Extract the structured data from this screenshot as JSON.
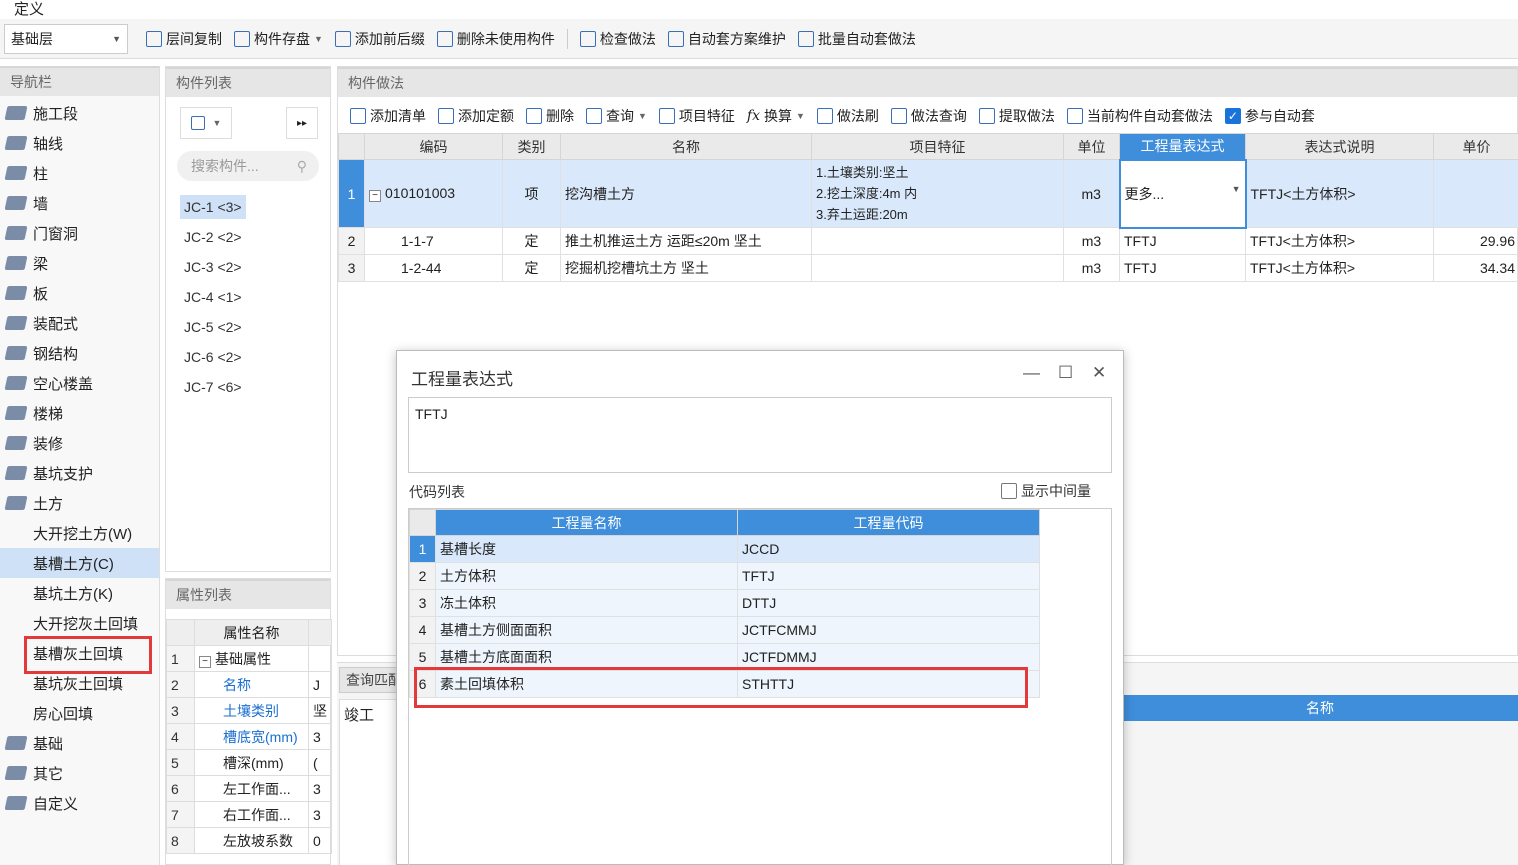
{
  "menu": {
    "title": "定义"
  },
  "toolbar": {
    "floor": "基础层",
    "buttons": [
      "层间复制",
      "构件存盘",
      "添加前后缀",
      "删除未使用构件",
      "检查做法",
      "自动套方案维护",
      "批量自动套做法"
    ]
  },
  "nav": {
    "title": "导航栏",
    "items": [
      "施工段",
      "轴线",
      "柱",
      "墙",
      "门窗洞",
      "梁",
      "板",
      "装配式",
      "钢结构",
      "空心楼盖",
      "楼梯",
      "装修",
      "基坑支护",
      "土方"
    ],
    "sub_items": [
      "大开挖土方(W)",
      "基槽土方(C)",
      "基坑土方(K)",
      "大开挖灰土回填",
      "基槽灰土回填",
      "基坑灰土回填",
      "房心回填"
    ],
    "items_after": [
      "基础",
      "其它",
      "自定义"
    ]
  },
  "component_list": {
    "title": "构件列表",
    "search_placeholder": "搜索构件...",
    "items": [
      "JC-1 <3>",
      "JC-2 <2>",
      "JC-3 <2>",
      "JC-4 <1>",
      "JC-5 <2>",
      "JC-6 <2>",
      "JC-7 <6>"
    ]
  },
  "attributes": {
    "title": "属性列表",
    "header": "属性名称",
    "rows": [
      {
        "n": "1",
        "name": "基础属性",
        "val": ""
      },
      {
        "n": "2",
        "name": "名称",
        "val": "J"
      },
      {
        "n": "3",
        "name": "土壤类别",
        "val": "坚"
      },
      {
        "n": "4",
        "name": "槽底宽(mm)",
        "val": "3"
      },
      {
        "n": "5",
        "name": "槽深(mm)",
        "val": "("
      },
      {
        "n": "6",
        "name": "左工作面...",
        "val": "3"
      },
      {
        "n": "7",
        "name": "右工作面...",
        "val": "3"
      },
      {
        "n": "8",
        "name": "左放坡系数",
        "val": "0"
      }
    ]
  },
  "method": {
    "title": "构件做法",
    "toolbar": [
      "添加清单",
      "添加定额",
      "删除",
      "查询",
      "项目特征",
      "换算",
      "做法刷",
      "做法查询",
      "提取做法",
      "当前构件自动套做法",
      "参与自动套"
    ],
    "columns": [
      "编码",
      "类别",
      "名称",
      "项目特征",
      "单位",
      "工程量表达式",
      "表达式说明",
      "单价"
    ],
    "rows": [
      {
        "n": "1",
        "code": "010101003",
        "type": "项",
        "name": "挖沟槽土方",
        "feature": [
          "1.土壤类别:坚土",
          "2.挖土深度:4m 内",
          "3.弃土运距:20m"
        ],
        "unit": "m3",
        "expr": "更多...",
        "desc": "TFTJ<土方体积>",
        "price": ""
      },
      {
        "n": "2",
        "code": "1-1-7",
        "type": "定",
        "name": "推土机推运土方 运距≤20m 坚土",
        "feature": [],
        "unit": "m3",
        "expr": "TFTJ",
        "desc": "TFTJ<土方体积>",
        "price": "29.96"
      },
      {
        "n": "3",
        "code": "1-2-44",
        "type": "定",
        "name": "挖掘机挖槽坑土方 坚土",
        "feature": [],
        "unit": "m3",
        "expr": "TFTJ",
        "desc": "TFTJ<土方体积>",
        "price": "34.34"
      }
    ]
  },
  "lower": {
    "tab": "查询匹配",
    "left_text": "竣工",
    "right_header": "名称"
  },
  "dialog": {
    "title": "工程量表达式",
    "expression": "TFTJ",
    "code_label": "代码列表",
    "show_mid": "显示中间量",
    "columns": [
      "工程量名称",
      "工程量代码"
    ],
    "rows": [
      {
        "n": "1",
        "name": "基槽长度",
        "code": "JCCD"
      },
      {
        "n": "2",
        "name": "土方体积",
        "code": "TFTJ"
      },
      {
        "n": "3",
        "name": "冻土体积",
        "code": "DTTJ"
      },
      {
        "n": "4",
        "name": "基槽土方侧面面积",
        "code": "JCTFCMMJ"
      },
      {
        "n": "5",
        "name": "基槽土方底面面积",
        "code": "JCTFDMMJ"
      },
      {
        "n": "6",
        "name": "素土回填体积",
        "code": "STHTTJ"
      }
    ]
  },
  "colors": {
    "accent": "#3e8edc",
    "highlight": "#e23a3a",
    "selected": "#cfe1f6"
  }
}
